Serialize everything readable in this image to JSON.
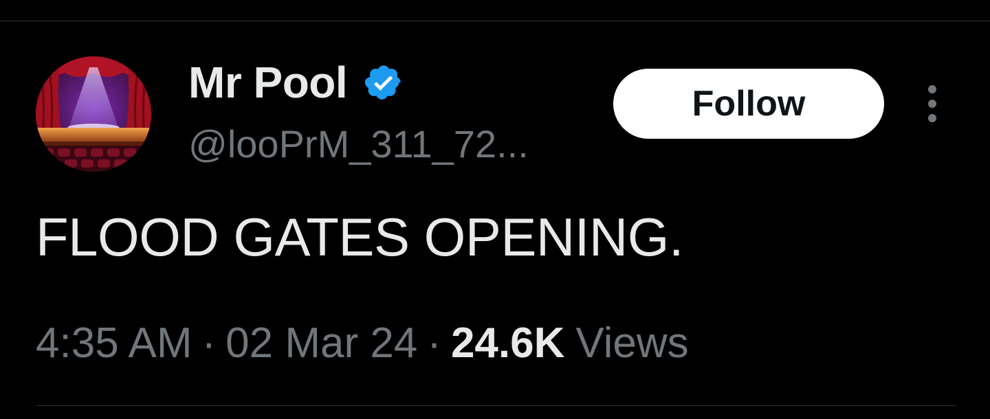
{
  "user": {
    "display_name": "Mr Pool",
    "handle": "@looPrM_311_72...",
    "verified_icon": "verified-badge-icon",
    "avatar_icon": "theater-stage-avatar"
  },
  "actions": {
    "follow_label": "Follow",
    "more_icon": "more-vertical-icon"
  },
  "tweet": {
    "text": "FLOOD GATES OPENING."
  },
  "meta": {
    "time": "4:35 AM",
    "separator": "·",
    "date": "02 Mar 24",
    "views_count": "24.6K",
    "views_label": "Views"
  },
  "colors": {
    "background": "#000000",
    "primary_text": "#e7e9ea",
    "secondary_text": "#71767b",
    "verified_blue": "#1d9bf0",
    "follow_bg": "#ffffff",
    "divider": "#2f3336"
  }
}
